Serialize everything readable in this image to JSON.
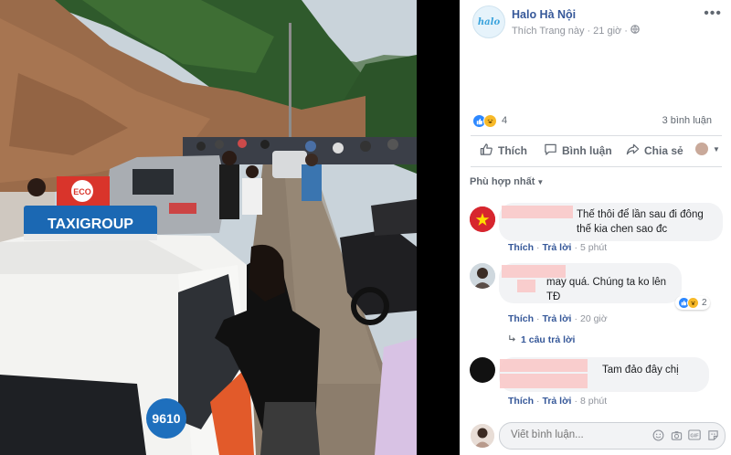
{
  "post": {
    "page_name": "Halo Hà Nội",
    "avatar_text": "halo",
    "like_page": "Thích Trang này",
    "separator": "·",
    "time": "21 giờ",
    "reaction_count": "4",
    "comment_count": "3 bình luận"
  },
  "photo": {
    "taxi_sign": "TAXIGROUP",
    "eco_label": "ECO",
    "taxi_number": "9610"
  },
  "actions": {
    "like": "Thích",
    "comment": "Bình luận",
    "share": "Chia sẻ"
  },
  "sort": {
    "label": "Phù hợp nhất"
  },
  "comments": [
    {
      "text": "Thế thôi để lần sau đi đông thế kia chen sao đc",
      "like": "Thích",
      "reply": "Trả lời",
      "time": "5 phút"
    },
    {
      "text": "may quá. Chúng ta ko lên TĐ",
      "like": "Thích",
      "reply": "Trả lời",
      "time": "20 giờ",
      "reactions": "2",
      "replies_link": "1 câu trả lời"
    },
    {
      "text": "Tam đảo đây chị",
      "like": "Thích",
      "reply": "Trả lời",
      "time": "8 phút"
    }
  ],
  "composer": {
    "placeholder": "Viết bình luận..."
  },
  "colors": {
    "link": "#365899",
    "muted": "#90949c",
    "like_blue": "#2d88ff"
  }
}
